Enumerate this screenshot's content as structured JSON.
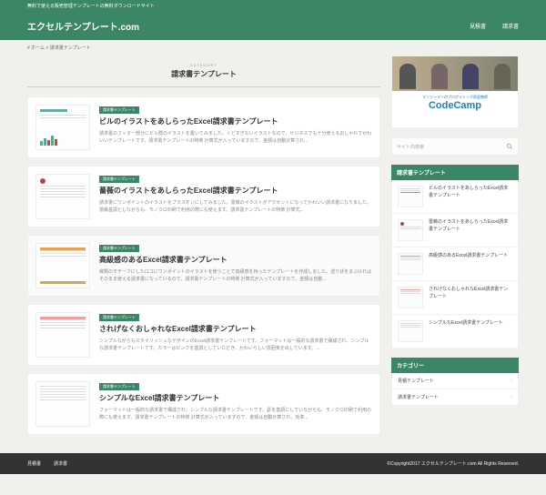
{
  "topbar": "無料で使える販売管理テンプレートの無料ダウンロードサイト",
  "site_title": "エクセルテンプレート.com",
  "nav": [
    "見積書",
    "請求書"
  ],
  "breadcrumb": "# ホーム > 請求書テンプレート",
  "category": {
    "label": "CATEGORY",
    "title": "請求書テンプレート"
  },
  "tag_label": "請求書テンプレート",
  "posts": [
    {
      "title": "ビルのイラストをあしらったExcel請求書テンプレート",
      "excerpt": "請求書のフッター部分にビル群のイラストを置いてみました。くどすぎないイラストなので、ビジネスでも十分使えるおしゃれでかわいいテンプレートです。請求書テンプレートの特徴 計算式が入っていますので、金額は自動計算され..."
    },
    {
      "title": "薔薇のイラストをあしらったExcel請求書テンプレート",
      "excerpt": "請求書にワンポイントのイラストをプラスオンにしてみました。薔薇のイラストがアクセントになってかわいい請求書になりました。薔薇基調としながらも、モノクロ印刷で利用の際にも使えます。請求書テンプレートの特徴 計算式..."
    },
    {
      "title": "高級感のあるExcel請求書テンプレート",
      "excerpt": "蝶類のモチーフにしたロゴにワンポイントのイラストを使うことで高級感を持ったテンプレートを作成しました。送り状をまぶければそのまま使える請求書になっているので、請求書テンプレートの特徴 計算式が入っていますので、金額は自動..."
    },
    {
      "title": "されげなくおしゃれなExcel請求書テンプレート",
      "excerpt": "シンプルながらもスタイリッシュなデザインのExcel請求書テンプレートです。フォーマットは一般的な請求書で構成され、シンプルな請求書テンプレートです。カラーはピンクを基調としていただき、かわいらしい雰囲気を出しています。..."
    },
    {
      "title": "シンプルなExcel請求書テンプレート",
      "excerpt": "フォーマットは一般的な請求書で構成され、シンプルな請求書テンプレートです。罫を基調にしていながらも、モノクロ印刷で利用の際にも使えます。請求書テンプレートの特徴 計算式が入っていますので、金額は自動計算され、効率..."
    }
  ],
  "ad": {
    "tagline": "マンツーマンのプログラミング家庭教師",
    "brand": "CodeCamp"
  },
  "search_placeholder": "サイト内検索",
  "widget_recent": "請求書テンプレート",
  "recent": [
    "ビルのイラストをあしらったExcel請求書テンプレート",
    "薔薇のイラストをあしらったExcel請求書テンプレート",
    "高級感のあるExcel請求書テンプレート",
    "されげなくおしゃれなExcel請求書テンプレート",
    "シンプルなExcel請求書テンプレート"
  ],
  "widget_cat": "カテゴリー",
  "cats": [
    "見積テンプレート",
    "請求書テンプレート"
  ],
  "copyright": "©Copyright2017 エクセルテンプレート.com All Rights Reserved."
}
